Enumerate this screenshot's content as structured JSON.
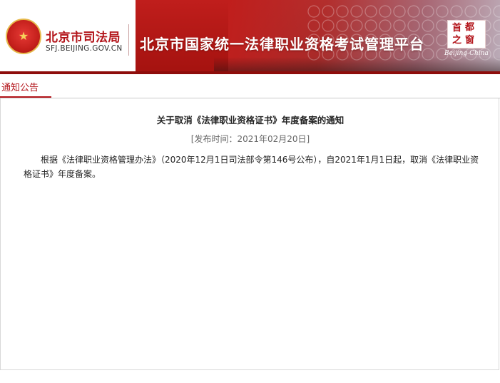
{
  "header": {
    "org_name": "北京市司法局",
    "org_domain": "SFJ.BEIJING.GOV.CN",
    "platform_title": "北京市国家统一法律职业资格考试管理平台",
    "seal_chars": [
      "首",
      "都",
      "之",
      "窗"
    ],
    "seal_caption": "Beijing-China",
    "colors": {
      "brand_red": "#b3141a",
      "banner_red": "#c01e1c"
    }
  },
  "tabs": [
    {
      "label": "通知公告",
      "active": true
    }
  ],
  "notice": {
    "title": "关于取消《法律职业资格证书》年度备案的通知",
    "publish_time": "[发布时间：2021年02月20日]",
    "body": "根据《法律职业资格管理办法》（2020年12月1日司法部令第146号公布），自2021年1月1日起，取消《法律职业资格证书》年度备案。"
  }
}
